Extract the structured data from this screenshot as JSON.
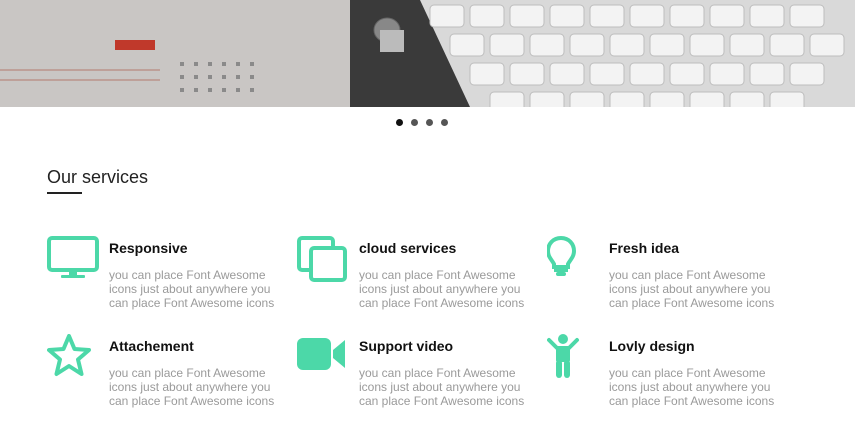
{
  "carousel": {
    "dots": [
      {
        "active": true
      },
      {
        "active": false
      },
      {
        "active": false
      },
      {
        "active": false
      }
    ]
  },
  "section": {
    "title": "Our services"
  },
  "accent_color": "#4cd8a8",
  "services": [
    {
      "icon": "desktop-icon",
      "title": "Responsive",
      "description": "you can place Font Awesome icons just about anywhere you can place Font Awesome icons"
    },
    {
      "icon": "copy-icon",
      "title": "cloud services",
      "description": "you can place Font Awesome icons just about anywhere you can place Font Awesome icons"
    },
    {
      "icon": "lightbulb-icon",
      "title": "Fresh idea",
      "description": "you can place Font Awesome icons just about anywhere you can place Font Awesome icons"
    },
    {
      "icon": "star-icon",
      "title": "Attachement",
      "description": "you can place Font Awesome icons just about anywhere you can place Font Awesome icons"
    },
    {
      "icon": "video-camera-icon",
      "title": "Support video",
      "description": "you can place Font Awesome icons just about anywhere you can place Font Awesome icons"
    },
    {
      "icon": "child-icon",
      "title": "Lovly design",
      "description": "you can place Font Awesome icons just about anywhere you can place Font Awesome icons"
    }
  ]
}
